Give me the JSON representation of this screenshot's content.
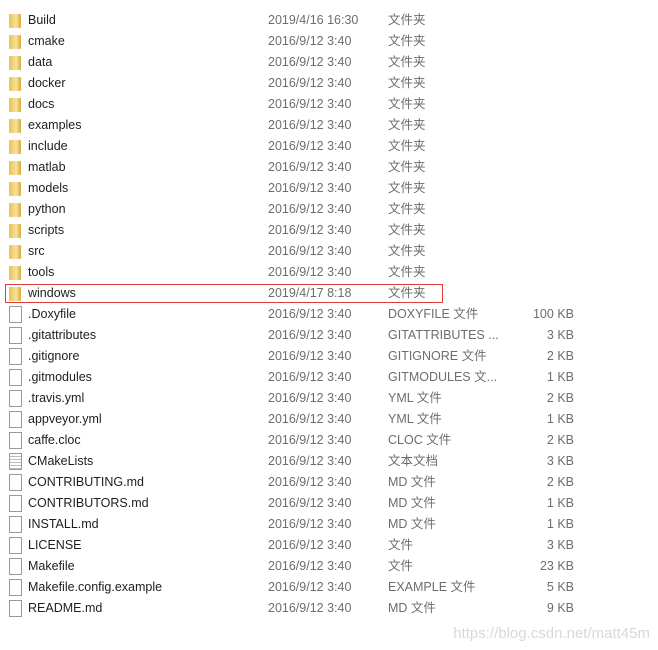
{
  "files": [
    {
      "name": "Build",
      "date": "2019/4/16 16:30",
      "type": "文件夹",
      "size": "",
      "kind": "folder-icon"
    },
    {
      "name": "cmake",
      "date": "2016/9/12 3:40",
      "type": "文件夹",
      "size": "",
      "kind": "folder-icon"
    },
    {
      "name": "data",
      "date": "2016/9/12 3:40",
      "type": "文件夹",
      "size": "",
      "kind": "folder-icon"
    },
    {
      "name": "docker",
      "date": "2016/9/12 3:40",
      "type": "文件夹",
      "size": "",
      "kind": "folder-icon"
    },
    {
      "name": "docs",
      "date": "2016/9/12 3:40",
      "type": "文件夹",
      "size": "",
      "kind": "folder-icon"
    },
    {
      "name": "examples",
      "date": "2016/9/12 3:40",
      "type": "文件夹",
      "size": "",
      "kind": "folder-icon"
    },
    {
      "name": "include",
      "date": "2016/9/12 3:40",
      "type": "文件夹",
      "size": "",
      "kind": "folder-icon"
    },
    {
      "name": "matlab",
      "date": "2016/9/12 3:40",
      "type": "文件夹",
      "size": "",
      "kind": "folder-icon"
    },
    {
      "name": "models",
      "date": "2016/9/12 3:40",
      "type": "文件夹",
      "size": "",
      "kind": "folder-icon"
    },
    {
      "name": "python",
      "date": "2016/9/12 3:40",
      "type": "文件夹",
      "size": "",
      "kind": "folder-icon"
    },
    {
      "name": "scripts",
      "date": "2016/9/12 3:40",
      "type": "文件夹",
      "size": "",
      "kind": "folder-icon"
    },
    {
      "name": "src",
      "date": "2016/9/12 3:40",
      "type": "文件夹",
      "size": "",
      "kind": "folder-icon"
    },
    {
      "name": "tools",
      "date": "2016/9/12 3:40",
      "type": "文件夹",
      "size": "",
      "kind": "folder-icon"
    },
    {
      "name": "windows",
      "date": "2019/4/17 8:18",
      "type": "文件夹",
      "size": "",
      "kind": "folder-icon",
      "highlighted": true
    },
    {
      "name": ".Doxyfile",
      "date": "2016/9/12 3:40",
      "type": "DOXYFILE 文件",
      "size": "100 KB",
      "kind": "file-icon"
    },
    {
      "name": ".gitattributes",
      "date": "2016/9/12 3:40",
      "type": "GITATTRIBUTES ...",
      "size": "3 KB",
      "kind": "file-icon"
    },
    {
      "name": ".gitignore",
      "date": "2016/9/12 3:40",
      "type": "GITIGNORE 文件",
      "size": "2 KB",
      "kind": "file-icon"
    },
    {
      "name": ".gitmodules",
      "date": "2016/9/12 3:40",
      "type": "GITMODULES 文...",
      "size": "1 KB",
      "kind": "file-icon"
    },
    {
      "name": ".travis.yml",
      "date": "2016/9/12 3:40",
      "type": "YML 文件",
      "size": "2 KB",
      "kind": "file-icon"
    },
    {
      "name": "appveyor.yml",
      "date": "2016/9/12 3:40",
      "type": "YML 文件",
      "size": "1 KB",
      "kind": "file-icon"
    },
    {
      "name": "caffe.cloc",
      "date": "2016/9/12 3:40",
      "type": "CLOC 文件",
      "size": "2 KB",
      "kind": "file-icon"
    },
    {
      "name": "CMakeLists",
      "date": "2016/9/12 3:40",
      "type": "文本文档",
      "size": "3 KB",
      "kind": "text-file-icon"
    },
    {
      "name": "CONTRIBUTING.md",
      "date": "2016/9/12 3:40",
      "type": "MD 文件",
      "size": "2 KB",
      "kind": "file-icon"
    },
    {
      "name": "CONTRIBUTORS.md",
      "date": "2016/9/12 3:40",
      "type": "MD 文件",
      "size": "1 KB",
      "kind": "file-icon"
    },
    {
      "name": "INSTALL.md",
      "date": "2016/9/12 3:40",
      "type": "MD 文件",
      "size": "1 KB",
      "kind": "file-icon"
    },
    {
      "name": "LICENSE",
      "date": "2016/9/12 3:40",
      "type": "文件",
      "size": "3 KB",
      "kind": "file-icon"
    },
    {
      "name": "Makefile",
      "date": "2016/9/12 3:40",
      "type": "文件",
      "size": "23 KB",
      "kind": "file-icon"
    },
    {
      "name": "Makefile.config.example",
      "date": "2016/9/12 3:40",
      "type": "EXAMPLE 文件",
      "size": "5 KB",
      "kind": "file-icon"
    },
    {
      "name": "README.md",
      "date": "2016/9/12 3:40",
      "type": "MD 文件",
      "size": "9 KB",
      "kind": "file-icon"
    }
  ],
  "watermark": "https://blog.csdn.net/matt45m",
  "highlight_color": "#e03c3c"
}
